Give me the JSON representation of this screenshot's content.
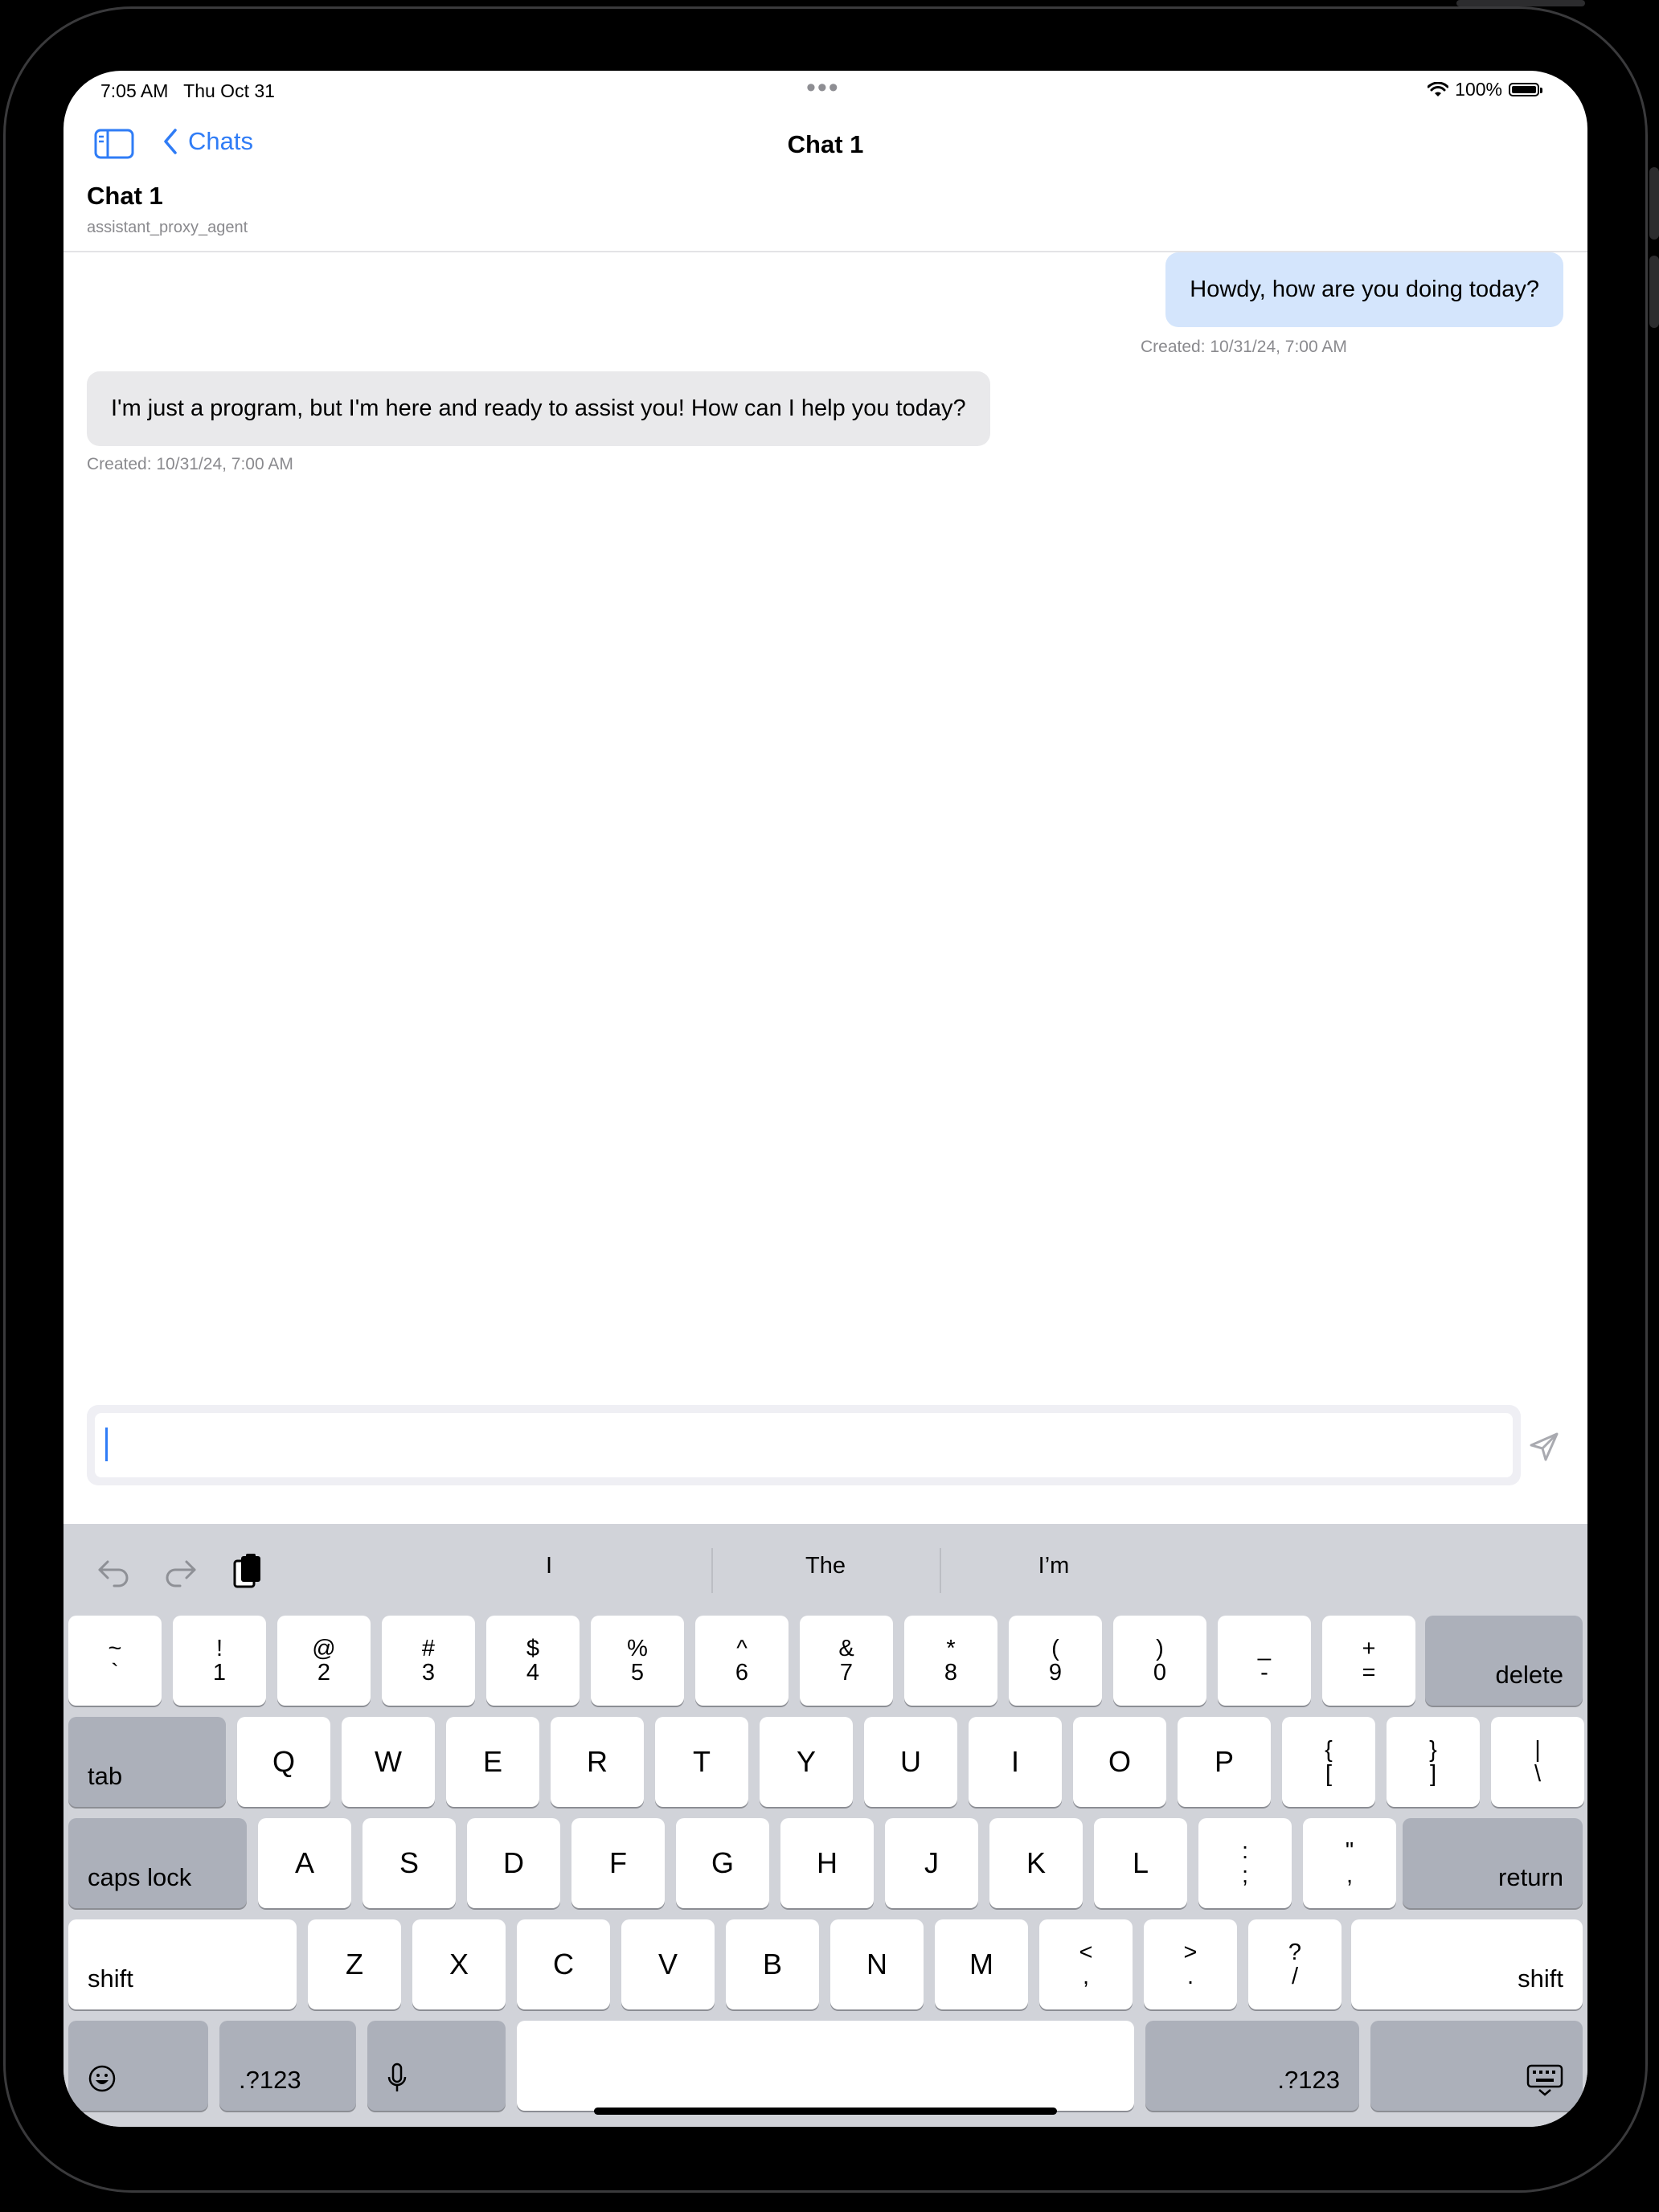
{
  "status_bar": {
    "time": "7:05 AM",
    "date": "Thu Oct 31",
    "dots": "•••",
    "battery": "100%"
  },
  "nav": {
    "back_label": "Chats",
    "title": "Chat 1"
  },
  "chat_header": {
    "title": "Chat 1",
    "subtitle": "assistant_proxy_agent"
  },
  "messages": [
    {
      "role": "user",
      "text": "Howdy, how are you doing today?",
      "meta": "Created: 10/31/24, 7:00 AM"
    },
    {
      "role": "assistant",
      "text": "I'm just a program, but I'm here and ready to assist you! How can I help you today?",
      "meta": "Created: 10/31/24, 7:00 AM"
    }
  ],
  "composer": {
    "value": "",
    "placeholder": ""
  },
  "keyboard": {
    "suggestions": [
      "I",
      "The",
      "I’m"
    ],
    "number_row": [
      {
        "top": "~",
        "bottom": "`"
      },
      {
        "top": "!",
        "bottom": "1"
      },
      {
        "top": "@",
        "bottom": "2"
      },
      {
        "top": "#",
        "bottom": "3"
      },
      {
        "top": "$",
        "bottom": "4"
      },
      {
        "top": "%",
        "bottom": "5"
      },
      {
        "top": "^",
        "bottom": "6"
      },
      {
        "top": "&",
        "bottom": "7"
      },
      {
        "top": "*",
        "bottom": "8"
      },
      {
        "top": "(",
        "bottom": "9"
      },
      {
        "top": ")",
        "bottom": "0"
      },
      {
        "top": "_",
        "bottom": "-"
      },
      {
        "top": "+",
        "bottom": "="
      }
    ],
    "delete_label": "delete",
    "tab_label": "tab",
    "row_q": [
      "Q",
      "W",
      "E",
      "R",
      "T",
      "Y",
      "U",
      "I",
      "O",
      "P"
    ],
    "row_q_symbols": [
      {
        "top": "{",
        "bottom": "["
      },
      {
        "top": "}",
        "bottom": "]"
      },
      {
        "top": "|",
        "bottom": "\\"
      }
    ],
    "caps_label": "caps lock",
    "row_a": [
      "A",
      "S",
      "D",
      "F",
      "G",
      "H",
      "J",
      "K",
      "L"
    ],
    "row_a_symbols": [
      {
        "top": ":",
        "bottom": ";"
      },
      {
        "top": "\"",
        "bottom": ","
      }
    ],
    "return_label": "return",
    "shift_label": "shift",
    "row_z": [
      "Z",
      "X",
      "C",
      "V",
      "B",
      "N",
      "M"
    ],
    "row_z_symbols": [
      {
        "top": "<",
        "bottom": ","
      },
      {
        "top": ">",
        "bottom": "."
      },
      {
        "top": "?",
        "bottom": "/"
      }
    ],
    "numbers_label": ".?123"
  },
  "colors": {
    "accent": "#2f7cf6",
    "user_bubble": "#d4e5fc",
    "assistant_bubble": "#e9e9eb",
    "keyboard_bg": "#d1d3d9",
    "key_dark": "#acb0ba"
  }
}
